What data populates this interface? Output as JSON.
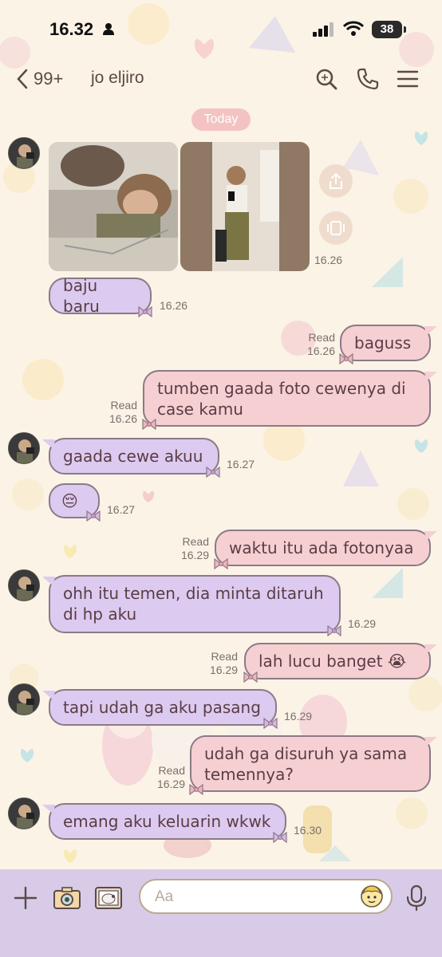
{
  "status_bar": {
    "time": "16.32",
    "battery": "38"
  },
  "header": {
    "unread_count": "99+",
    "title": "jo eljiro"
  },
  "date_label": "Today",
  "messages": [
    {
      "side": "left",
      "text": "baju baru",
      "time": "16.26",
      "read": ""
    },
    {
      "side": "right",
      "text": "baguss",
      "time": "16.26",
      "read": "Read"
    },
    {
      "side": "right",
      "text": "tumben gaada foto cewenya di case kamu",
      "time": "16.26",
      "read": "Read"
    },
    {
      "side": "left",
      "text": "gaada cewe akuu",
      "time": "16.27",
      "read": ""
    },
    {
      "side": "left",
      "text": "😔",
      "time": "16.27",
      "read": ""
    },
    {
      "side": "right",
      "text": "waktu itu ada fotonyaa",
      "time": "16.29",
      "read": "Read"
    },
    {
      "side": "left",
      "text": "ohh itu temen, dia minta ditaruh di hp aku",
      "time": "16.29",
      "read": ""
    },
    {
      "side": "right",
      "text": "lah lucu banget 😭",
      "time": "16.29",
      "read": "Read"
    },
    {
      "side": "left",
      "text": "tapi udah ga aku pasang",
      "time": "16.29",
      "read": ""
    },
    {
      "side": "right",
      "text": "udah ga disuruh ya sama temennya?",
      "time": "16.29",
      "read": "Read"
    },
    {
      "side": "left",
      "text": "emang aku keluarin wkwk",
      "time": "16.30",
      "read": ""
    }
  ],
  "photo_message": {
    "time": "16.26"
  },
  "input": {
    "placeholder": "Aa"
  },
  "icons": {
    "back": "chevron-left-icon",
    "search": "search-icon",
    "call": "phone-icon",
    "menu": "hamburger-menu-icon",
    "share": "share-icon",
    "expand": "expand-icon",
    "add": "plus-icon",
    "camera": "camera-icon",
    "gallery": "gallery-icon",
    "sticker": "sticker-icon",
    "mic": "microphone-icon",
    "bow": "bow-icon"
  },
  "colors": {
    "background": "#fbf3e6",
    "left_bubble": "#dccaf0",
    "right_bubble": "#f6cfd3",
    "bubble_border": "#8b7a86",
    "date_pill": "#f3c3c3",
    "bottom_bar": "#d8cbe8"
  }
}
